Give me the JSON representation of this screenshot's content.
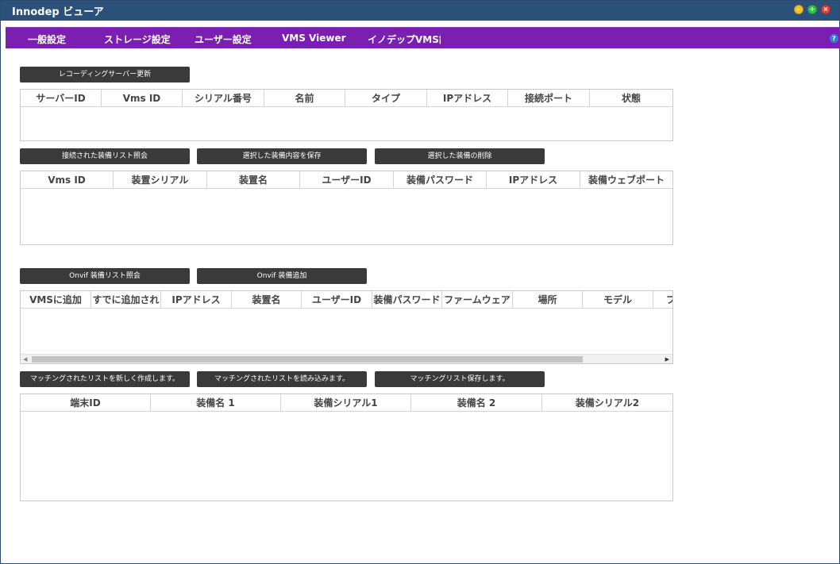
{
  "window": {
    "title": "Innodep ビューア"
  },
  "menu": {
    "items": [
      "一般設定",
      "ストレージ設定",
      "ユーザー設定",
      "VMS Viewer",
      "イノデップVMS設"
    ],
    "help_icon": "?"
  },
  "servers": {
    "refresh_label": "レコーディングサーバー更新",
    "columns": [
      "サーバーID",
      "Vms ID",
      "シリアル番号",
      "名前",
      "タイプ",
      "IPアドレス",
      "接続ポート",
      "状態"
    ]
  },
  "devices": {
    "buttons": [
      "接続された装備リスト照会",
      "選択した装備内容を保存",
      "選択した装備の削除"
    ],
    "columns": [
      "Vms ID",
      "装置シリアル",
      "装置名",
      "ユーザーID",
      "装備パスワード",
      "IPアドレス",
      "装備ウェブポート"
    ]
  },
  "onvif": {
    "buttons": [
      "Onvif 装備リスト照会",
      "Onvif 装備追加"
    ],
    "columns": [
      "VMSに追加",
      "すでに追加され",
      "IPアドレス",
      "装置名",
      "ユーザーID",
      "装備パスワード",
      "ファームウェア",
      "場所",
      "モデル",
      "プ"
    ]
  },
  "matching": {
    "buttons": [
      "マッチングされたリストを新しく作成します。",
      "マッチングされたリストを読み込みます。",
      "マッチングリスト保存します。"
    ],
    "columns": [
      "端末ID",
      "装備名 1",
      "装備シリアル1",
      "装備名 2",
      "装備シリアル2"
    ]
  },
  "colors": {
    "titlebar": "#2b5079",
    "menubar": "#7a1fb0",
    "button": "#3a3a3a"
  },
  "icons": {
    "minimize": "minimize-icon",
    "maximize": "maximize-icon",
    "close": "close-icon",
    "help": "help-icon"
  }
}
